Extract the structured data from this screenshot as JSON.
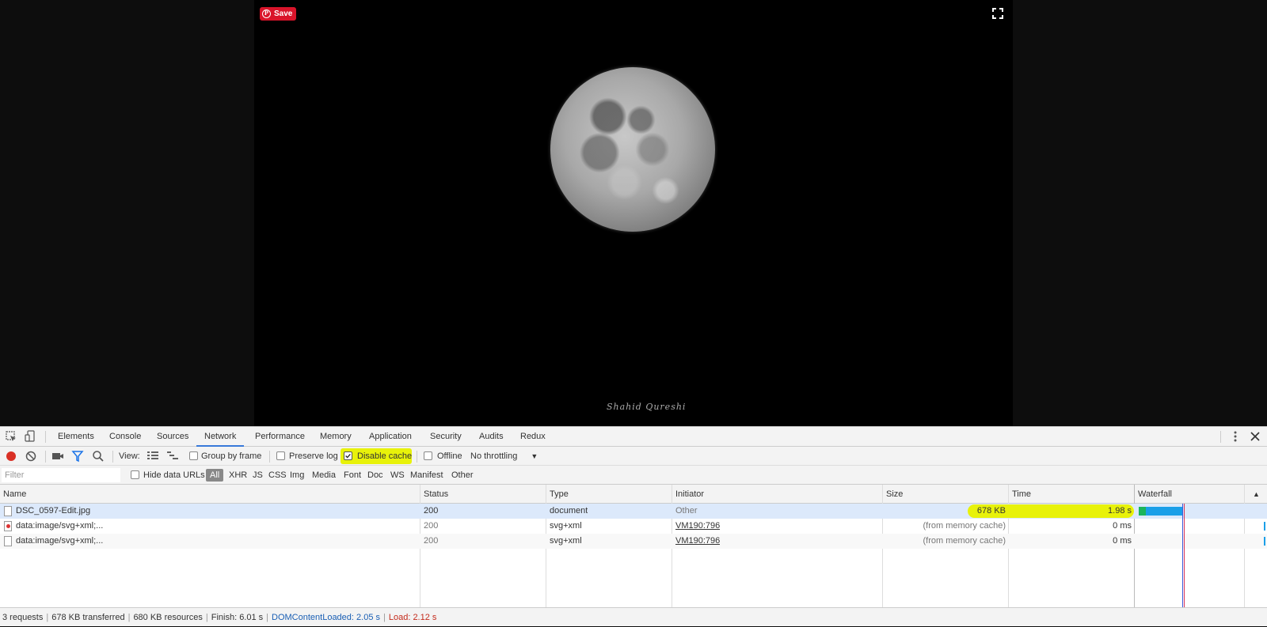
{
  "page": {
    "save_label": "Save",
    "pinterest_icon": "pinterest-icon",
    "signature_text": "Shahid Qureshi"
  },
  "devtools": {
    "tabs": [
      "Elements",
      "Console",
      "Sources",
      "Network",
      "Performance",
      "Memory",
      "Application",
      "Security",
      "Audits",
      "Redux"
    ],
    "active_tab": "Network",
    "toolbar": {
      "view_label": "View:",
      "group_by_frame": "Group by frame",
      "preserve_log": "Preserve log",
      "disable_cache": "Disable cache",
      "disable_cache_checked": true,
      "offline": "Offline",
      "throttling": "No throttling"
    },
    "filterbar": {
      "placeholder": "Filter",
      "hide_data_urls": "Hide data URLs",
      "types": [
        "All",
        "XHR",
        "JS",
        "CSS",
        "Img",
        "Media",
        "Font",
        "Doc",
        "WS",
        "Manifest",
        "Other"
      ]
    },
    "columns": {
      "name": "Name",
      "status": "Status",
      "type": "Type",
      "initiator": "Initiator",
      "size": "Size",
      "time": "Time",
      "waterfall": "Waterfall"
    },
    "rows": [
      {
        "name": "DSC_0597-Edit.jpg",
        "status": "200",
        "type": "document",
        "initiator": "Other",
        "size": "678 KB",
        "time": "1.98 s"
      },
      {
        "name": "data:image/svg+xml;...",
        "status": "200",
        "type": "svg+xml",
        "initiator": "VM190:796",
        "size": "(from memory cache)",
        "time": "0 ms"
      },
      {
        "name": "data:image/svg+xml;...",
        "status": "200",
        "type": "svg+xml",
        "initiator": "VM190:796",
        "size": "(from memory cache)",
        "time": "0 ms"
      }
    ],
    "status": {
      "requests": "3 requests",
      "transferred": "678 KB transferred",
      "resources": "680 KB resources",
      "finish": "Finish: 6.01 s",
      "dom_content_loaded": "DOMContentLoaded: 2.05 s",
      "load": "Load: 2.12 s"
    },
    "colors": {
      "highlight": "#e8f20a",
      "active_tab": "#3879d9",
      "record": "#d93025",
      "waterfall_blue": "#1a9fe8",
      "waterfall_green": "#1bb55c"
    }
  }
}
